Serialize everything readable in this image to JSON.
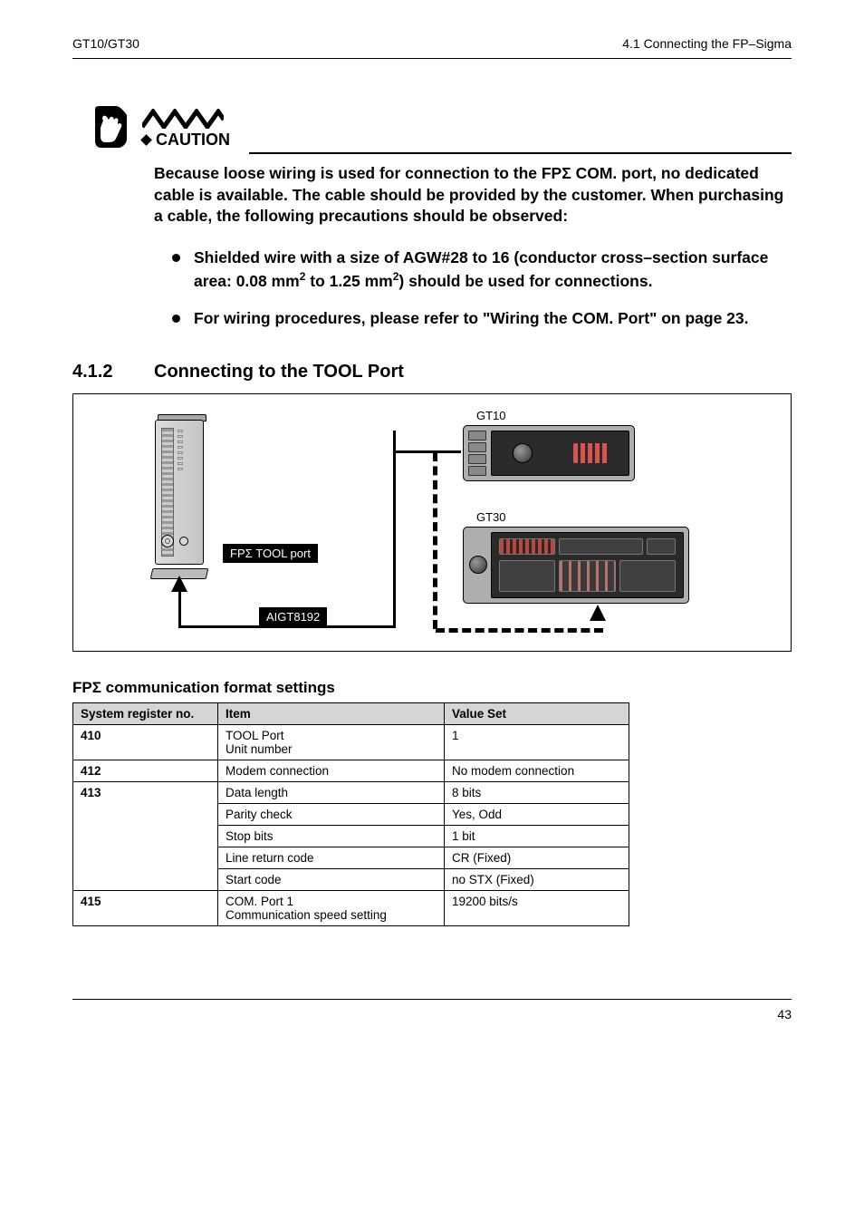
{
  "header": {
    "left": "GT10/GT30",
    "right": "4.1   Connecting the FP–Sigma"
  },
  "caution": {
    "label": "CAUTION",
    "text_part1": "Because loose wiring is used for connection to the FP",
    "sigma1": "Σ",
    "text_part2": " COM. port, no dedicated cable is available. The cable should be provided by the customer. When purchasing a cable, the following precautions should be observed:",
    "bullets": [
      {
        "pre": "Shielded wire with a size of AGW#28 to 16 (conductor cross–section surface area: 0.08 mm",
        "sup1": "2",
        "mid": " to 1.25 mm",
        "sup2": "2",
        "post": ") should be used for connections."
      },
      {
        "pre": "For wiring procedures, please refer to \"Wiring the COM. Port\" on page 23.",
        "sup1": "",
        "mid": "",
        "sup2": "",
        "post": ""
      }
    ]
  },
  "section": {
    "number": "4.1.2",
    "title": "Connecting to the TOOL Port"
  },
  "diagram": {
    "tool_port_label": "FPΣ TOOL port",
    "cable_label": "AIGT8192",
    "gt10_label": "GT10",
    "gt30_label": "GT30"
  },
  "sub_heading_pre": "FP",
  "sub_heading_sigma": "Σ",
  "sub_heading_post": " communication format settings",
  "table": {
    "headers": [
      "System register no.",
      "Item",
      "Value Set"
    ],
    "rows": [
      {
        "reg": "410",
        "item": "TOOL Port\nUnit number",
        "value": "1",
        "rowspan": 1
      },
      {
        "reg": "412",
        "item": "Modem connection",
        "value": "No modem connection",
        "rowspan": 1
      },
      {
        "reg": "413",
        "item": "Data length",
        "value": "8 bits",
        "rowspan": 5,
        "first": true
      },
      {
        "reg": "",
        "item": "Parity check",
        "value": "Yes, Odd"
      },
      {
        "reg": "",
        "item": "Stop bits",
        "value": "1 bit"
      },
      {
        "reg": "",
        "item": "Line return code",
        "value": "CR (Fixed)"
      },
      {
        "reg": "",
        "item": "Start code",
        "value": "no STX (Fixed)"
      },
      {
        "reg": "415",
        "item": "COM. Port 1\nCommunication speed setting",
        "value": "19200 bits/s",
        "rowspan": 1
      }
    ]
  },
  "footer": {
    "page": "43"
  }
}
